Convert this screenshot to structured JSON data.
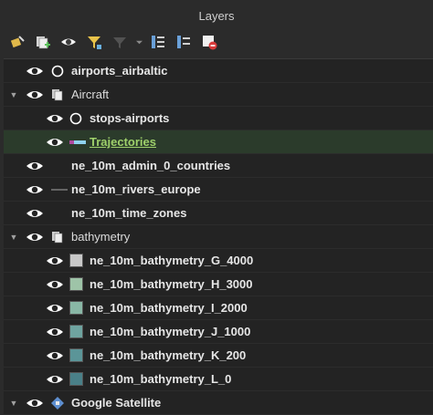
{
  "panel": {
    "title": "Layers"
  },
  "toolbar": {
    "buttons": [
      {
        "name": "style-manager-icon"
      },
      {
        "name": "add-group-icon"
      },
      {
        "name": "manage-visibility-icon"
      },
      {
        "name": "filter-legend-icon"
      },
      {
        "name": "filter-expression-icon"
      },
      {
        "name": "expand-all-icon"
      },
      {
        "name": "collapse-all-icon"
      },
      {
        "name": "remove-layer-icon"
      }
    ]
  },
  "layers": [
    {
      "label": "airports_airbaltic",
      "type": "layer"
    },
    {
      "label": "Aircraft",
      "type": "group"
    },
    {
      "label": "stops-airports",
      "type": "layer"
    },
    {
      "label": "Trajectories",
      "type": "layer"
    },
    {
      "label": "ne_10m_admin_0_countries",
      "type": "layer"
    },
    {
      "label": "ne_10m_rivers_europe",
      "type": "layer"
    },
    {
      "label": "ne_10m_time_zones",
      "type": "layer"
    },
    {
      "label": "bathymetry",
      "type": "group"
    },
    {
      "label": "ne_10m_bathymetry_G_4000",
      "type": "layer",
      "color": "#c8c8c8"
    },
    {
      "label": "ne_10m_bathymetry_H_3000",
      "type": "layer",
      "color": "#9ec4a8"
    },
    {
      "label": "ne_10m_bathymetry_I_2000",
      "type": "layer",
      "color": "#89b7a6"
    },
    {
      "label": "ne_10m_bathymetry_J_1000",
      "type": "layer",
      "color": "#6fa4a0"
    },
    {
      "label": "ne_10m_bathymetry_K_200",
      "type": "layer",
      "color": "#5b9598"
    },
    {
      "label": "ne_10m_bathymetry_L_0",
      "type": "layer",
      "color": "#4a8088"
    },
    {
      "label": "Google Satellite",
      "type": "layer"
    }
  ]
}
